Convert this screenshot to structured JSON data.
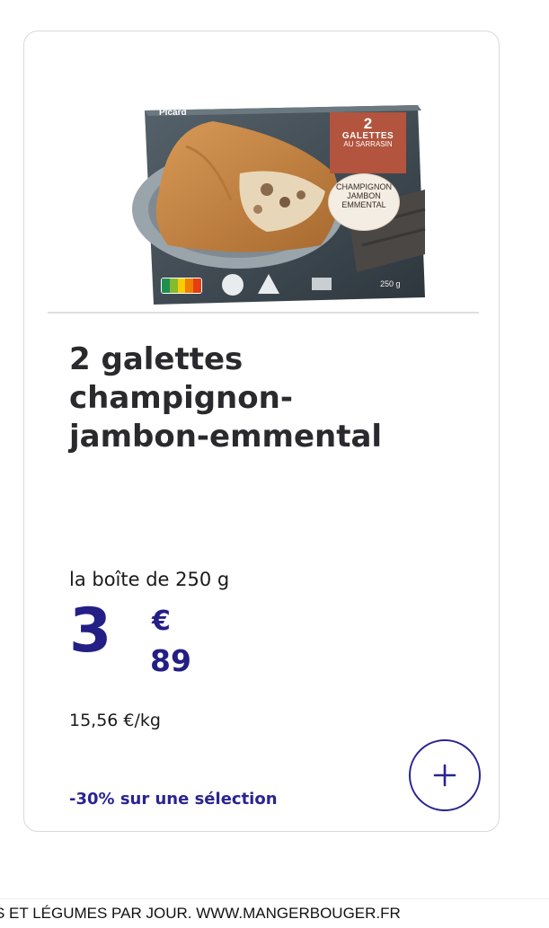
{
  "product": {
    "image": {
      "badge_number": "2",
      "badge_line1": "GALETTES",
      "badge_line2": "AU SARRASIN",
      "flavor_lines": [
        "CHAMPIGNON",
        "JAMBON",
        "EMMENTAL"
      ],
      "brand": "Picard",
      "weight": "250 g",
      "colors": {
        "box": "#3f4a52",
        "badge": "#b2543e",
        "crepe": "#c98a48"
      }
    },
    "title_lines": [
      "2 galettes",
      "champignon-",
      "jambon-emmental"
    ],
    "unit": "la boîte de 250 g",
    "price": {
      "integer": "3",
      "currency": "€",
      "decimal": "89"
    },
    "per_kg": "15,56 €/kg",
    "promo": "-30% sur une sélection",
    "add_button": {
      "icon": "plus-icon"
    }
  },
  "footer": {
    "text": "S ET LÉGUMES PAR JOUR. WWW.MANGERBOUGER.FR"
  },
  "colors": {
    "accent": "#241f85",
    "card_border": "#d9d9de"
  }
}
